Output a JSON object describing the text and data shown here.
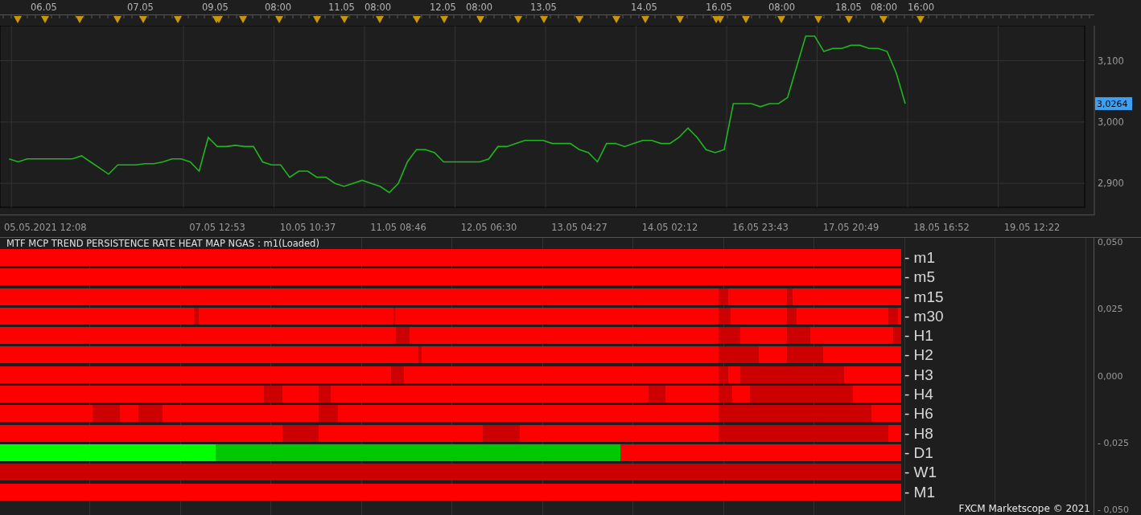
{
  "top_axis": {
    "labels": [
      "06.05",
      "07.05",
      "09.05",
      "08:00",
      "11.05",
      "08:00",
      "12.05",
      "08:00",
      "13.05",
      "14.05",
      "16.05",
      "08:00",
      "18.05",
      "08:00",
      "16:00"
    ]
  },
  "price_chart": {
    "price_tag": "3,0264",
    "chart_data": {
      "type": "line",
      "grid": true,
      "categories": [
        null,
        null,
        null,
        null,
        null,
        "05.05.2021 12:08",
        null,
        null,
        null,
        null,
        null,
        null,
        null,
        null,
        null,
        null,
        null,
        null,
        null,
        null,
        null,
        null,
        null,
        null,
        "07.05 12:53",
        null,
        null,
        null,
        null,
        null,
        null,
        null,
        null,
        null,
        "10.05 10:37",
        null,
        null,
        null,
        null,
        null,
        null,
        null,
        null,
        null,
        "11.05 08:46",
        null,
        null,
        null,
        null,
        null,
        null,
        null,
        null,
        null,
        "12.05 06:30",
        null,
        null,
        null,
        null,
        null,
        null,
        null,
        null,
        null,
        "13.05 04:27",
        null,
        null,
        null,
        null,
        null,
        null,
        null,
        null,
        null,
        "14.05 02:12",
        null,
        null,
        null,
        null,
        null,
        null,
        null,
        null,
        null,
        "16.05 23:43",
        null,
        null,
        null,
        null,
        null,
        null,
        null,
        null,
        null,
        "17.05 20:49",
        null,
        null,
        null,
        null,
        null,
        null,
        null,
        null,
        null,
        "18.05 16:52",
        null,
        null,
        null,
        null,
        null,
        null,
        null,
        null,
        null,
        "19.05 12:22"
      ],
      "series": [
        {
          "color": "#21b521",
          "values": [
            null,
            2940,
            2935,
            2940,
            2940,
            2940,
            2940,
            2940,
            2940,
            2945,
            2935,
            2925,
            2915,
            2930,
            2930,
            2930,
            2932,
            2932,
            2935,
            2940,
            2940,
            2935,
            2920,
            2975,
            2960,
            2960,
            2962,
            2960,
            2960,
            2935,
            2930,
            2930,
            2910,
            2920,
            2920,
            2910,
            2910,
            2900,
            2895,
            2900,
            2905,
            2900,
            2895,
            2885,
            2900,
            2935,
            2955,
            2955,
            2950,
            2935,
            2935,
            2935,
            2935,
            2935,
            2940,
            2960,
            2960,
            2965,
            2970,
            2970,
            2970,
            2965,
            2965,
            2965,
            2955,
            2950,
            2935,
            2965,
            2965,
            2960,
            2965,
            2970,
            2970,
            2965,
            2965,
            2975,
            2990,
            2975,
            2955,
            2950,
            2955,
            3030,
            3030,
            3030,
            3025,
            3030,
            3030,
            3040,
            3090,
            3140,
            3140,
            3115,
            3120,
            3120,
            3125,
            3125,
            3120,
            3120,
            3115,
            3080,
            3030,
            null,
            null,
            null,
            null,
            null,
            null,
            null,
            null,
            null,
            null,
            null,
            null,
            null,
            null
          ]
        }
      ],
      "ylim": [
        2861,
        3157
      ],
      "yticks": [
        {
          "value": 2900,
          "label": "2,900"
        },
        {
          "value": 3000,
          "label": "3,000"
        },
        {
          "value": 3100,
          "label": "3,100"
        }
      ]
    }
  },
  "heatmap": {
    "title": "MTF MCP TREND PERSISTENCE RATE HEAT MAP NGAS : m1(Loaded)",
    "y_axis": [
      "0,050",
      "0,025",
      "0,000",
      "- 0,025",
      "- 0,050"
    ],
    "rows": [
      {
        "label": "- m1",
        "segments": [
          {
            "color": "#ff0000"
          }
        ]
      },
      {
        "label": "- m5",
        "segments": [
          {
            "color": "#ff0000"
          }
        ]
      },
      {
        "label": "- m15",
        "segments": [
          {
            "color": "#ff0000"
          },
          {
            "color": "#cc0000"
          },
          {
            "color": "#ff0000"
          },
          {
            "color": "#cc0000"
          },
          {
            "color": "#ff0000"
          }
        ]
      },
      {
        "label": "- m30",
        "segments": [
          {
            "color": "#ff0000"
          },
          {
            "color": "#cc0000"
          },
          {
            "color": "#ff0000"
          },
          {
            "color": "#cc0000"
          },
          {
            "color": "#ff0000"
          },
          {
            "color": "#cc0000"
          },
          {
            "color": "#ff0000"
          },
          {
            "color": "#cc0000"
          },
          {
            "color": "#ff0000"
          },
          {
            "color": "#cc0000"
          },
          {
            "color": "#ff0000"
          }
        ]
      },
      {
        "label": "- H1",
        "segments": [
          {
            "color": "#ff0000"
          },
          {
            "color": "#cc0000"
          },
          {
            "color": "#ff0000"
          },
          {
            "color": "#cc0000"
          },
          {
            "color": "#ff0000"
          },
          {
            "color": "#cc0000"
          },
          {
            "color": "#ff0000"
          },
          {
            "color": "#cc0000"
          }
        ]
      },
      {
        "label": "- H2",
        "segments": [
          {
            "color": "#ff0000"
          },
          {
            "color": "#cc0000"
          },
          {
            "color": "#ff0000"
          },
          {
            "color": "#cc0000"
          },
          {
            "color": "#ff0000"
          },
          {
            "color": "#cc0000"
          },
          {
            "color": "#ff0000"
          }
        ]
      },
      {
        "label": "- H3",
        "segments": [
          {
            "color": "#ff0000"
          },
          {
            "color": "#cc0000"
          },
          {
            "color": "#ff0000"
          },
          {
            "color": "#cc0000"
          },
          {
            "color": "#ff0000"
          },
          {
            "color": "#cc0000"
          },
          {
            "color": "#ff0000"
          }
        ]
      },
      {
        "label": "- H4",
        "segments": [
          {
            "color": "#ff0000"
          },
          {
            "color": "#cc0000"
          },
          {
            "color": "#ff0000"
          },
          {
            "color": "#cc0000"
          },
          {
            "color": "#ff0000"
          },
          {
            "color": "#cc0000"
          },
          {
            "color": "#ff0000"
          },
          {
            "color": "#cc0000"
          },
          {
            "color": "#ff0000"
          },
          {
            "color": "#cc0000"
          },
          {
            "color": "#ff0000"
          }
        ]
      },
      {
        "label": "- H6",
        "segments": [
          {
            "color": "#ff0000"
          },
          {
            "color": "#cc0000"
          },
          {
            "color": "#ff0000"
          },
          {
            "color": "#cc0000"
          },
          {
            "color": "#ff0000"
          },
          {
            "color": "#cc0000"
          },
          {
            "color": "#ff0000"
          },
          {
            "color": "#cc0000"
          },
          {
            "color": "#ff0000"
          }
        ]
      },
      {
        "label": "- H8",
        "segments": [
          {
            "color": "#ff0000"
          },
          {
            "color": "#cc0000"
          },
          {
            "color": "#ff0000"
          },
          {
            "color": "#cc0000"
          },
          {
            "color": "#ff0000"
          },
          {
            "color": "#cc0000"
          },
          {
            "color": "#ff0000"
          }
        ]
      },
      {
        "label": "- D1",
        "segments": [
          {
            "color": "#00ff00"
          },
          {
            "color": "#00c800"
          },
          {
            "color": "#ff0000"
          }
        ]
      },
      {
        "label": "- W1",
        "segments": [
          {
            "color": "#cc0000"
          }
        ]
      },
      {
        "label": "- M1",
        "segments": [
          {
            "color": "#ff0000"
          }
        ]
      }
    ],
    "footer": "FXCM Marketscope © 2021"
  }
}
